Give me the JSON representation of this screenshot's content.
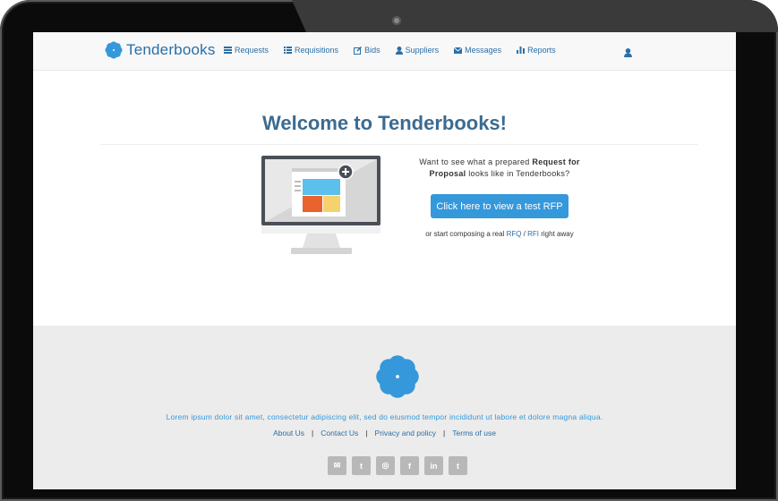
{
  "brand": {
    "name": "Tenderbooks",
    "color": "#3498db"
  },
  "nav": {
    "items": [
      {
        "label": "Requests",
        "icon": "list-icon"
      },
      {
        "label": "Requisitions",
        "icon": "list-icon"
      },
      {
        "label": "Bids",
        "icon": "edit-icon"
      },
      {
        "label": "Suppliers",
        "icon": "user-icon"
      },
      {
        "label": "Messages",
        "icon": "envelope-icon"
      },
      {
        "label": "Reports",
        "icon": "bar-chart-icon"
      }
    ],
    "user_icon": "user-icon"
  },
  "main": {
    "title": "Welcome to Tenderbooks!",
    "desc_part1": "Want to see what a prepared ",
    "desc_bold": "Request for Proposal",
    "desc_part2": " looks like in Tenderbooks?",
    "cta_label": "Click here to view a test RFP",
    "alt_prefix": "or start composing a real ",
    "alt_rfq": "RFQ",
    "alt_sep": " / ",
    "alt_rfi": "RFI",
    "alt_suffix": " right away"
  },
  "footer": {
    "text": "Lorem ipsum dolor sit amet, consectetur adipiscing elit, sed do eiusmod tempor incididunt ut labore et dolore magna aliqua.",
    "links": [
      "About Us",
      "Contact Us",
      "Privacy and policy",
      "Terms of use"
    ],
    "link_separator": "|",
    "socials": [
      {
        "icon": "envelope-icon",
        "glyph": "✉"
      },
      {
        "icon": "twitter-icon",
        "glyph": "t"
      },
      {
        "icon": "dribbble-icon",
        "glyph": "◎"
      },
      {
        "icon": "facebook-icon",
        "glyph": "f"
      },
      {
        "icon": "linkedin-icon",
        "glyph": "in"
      },
      {
        "icon": "tumblr-icon",
        "glyph": "t"
      }
    ]
  }
}
